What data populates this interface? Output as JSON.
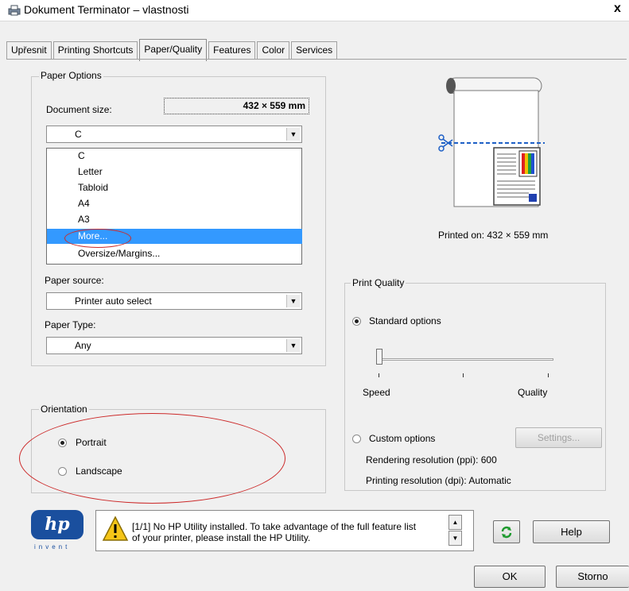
{
  "window": {
    "title": "Dokument Terminator – vlastnosti",
    "close_glyph": "x"
  },
  "tabs": [
    {
      "label": "Upřesnit"
    },
    {
      "label": "Printing Shortcuts"
    },
    {
      "label": "Paper/Quality",
      "active": true
    },
    {
      "label": "Features"
    },
    {
      "label": "Color"
    },
    {
      "label": "Services"
    }
  ],
  "paper_options": {
    "legend": "Paper Options",
    "document_size_label": "Document size:",
    "document_size_value": "432 × 559 mm",
    "size_selected": "C",
    "size_options": [
      "C",
      "Letter",
      "Tabloid",
      "A4",
      "A3",
      "More...",
      "Oversize/Margins..."
    ],
    "highlighted_option": "More...",
    "paper_source_label": "Paper source:",
    "paper_source_value": "Printer auto select",
    "paper_type_label": "Paper Type:",
    "paper_type_value": "Any"
  },
  "preview": {
    "printed_on": "Printed on: 432 × 559 mm"
  },
  "orientation": {
    "legend": "Orientation",
    "portrait": "Portrait",
    "landscape": "Landscape",
    "selected": "Portrait"
  },
  "print_quality": {
    "legend": "Print Quality",
    "standard": "Standard options",
    "speed": "Speed",
    "quality": "Quality",
    "slider_level": 0,
    "custom": "Custom options",
    "settings_button": "Settings...",
    "rendering": "Rendering resolution (ppi): 600",
    "printing": "Printing resolution (dpi): Automatic",
    "selected": "Standard options"
  },
  "notice": {
    "line1": "[1/1] No HP Utility installed. To take advantage of the full feature list",
    "line2": "of your printer, please install the HP Utility."
  },
  "logo": {
    "mark": "hp",
    "tagline": "invent",
    "color": "#1a4f9e"
  },
  "buttons": {
    "help": "Help",
    "ok": "OK",
    "cancel": "Storno"
  },
  "colors": {
    "selection": "#3399ff",
    "annotation_red": "#cc2a2a"
  }
}
